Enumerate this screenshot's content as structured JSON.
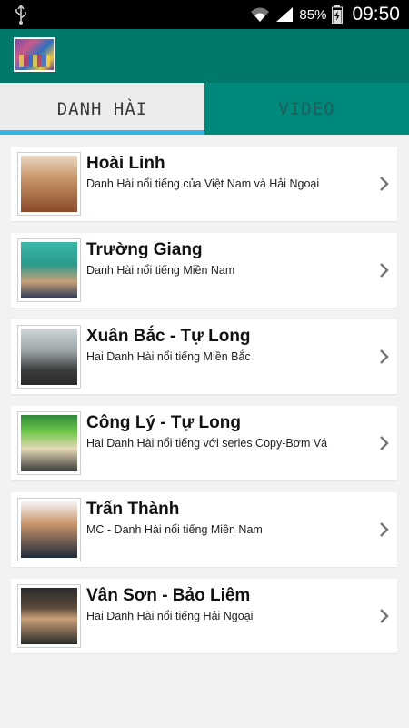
{
  "status_bar": {
    "battery": "85%",
    "time": "09:50"
  },
  "app_bar": {
    "logo_icon": "app-logo-icon"
  },
  "tabs": [
    {
      "label": "DANH HÀI",
      "active": true
    },
    {
      "label": "VIDEO",
      "active": false
    }
  ],
  "list": [
    {
      "name": "Hoài Linh",
      "desc": "Danh Hài nổi tiếng của Việt Nam và Hải Ngoại"
    },
    {
      "name": "Trường Giang",
      "desc": "Danh Hài nổi tiếng Miền Nam"
    },
    {
      "name": "Xuân Bắc - Tự Long",
      "desc": "Hai Danh Hài nổi tiếng Miền Bắc"
    },
    {
      "name": "Công Lý - Tự Long",
      "desc": "Hai Danh Hài nổi tiếng với series Copy-Bơm Vá"
    },
    {
      "name": "Trấn Thành",
      "desc": "MC - Danh Hài nổi tiếng Miền Nam"
    },
    {
      "name": "Vân Sơn - Bảo Liêm",
      "desc": "Hai Danh Hài nổi tiếng Hải Ngoại"
    }
  ],
  "colors": {
    "app_bar": "#00796b",
    "tab_indicator": "#33b5e5",
    "inactive_tab": "#00897b"
  }
}
